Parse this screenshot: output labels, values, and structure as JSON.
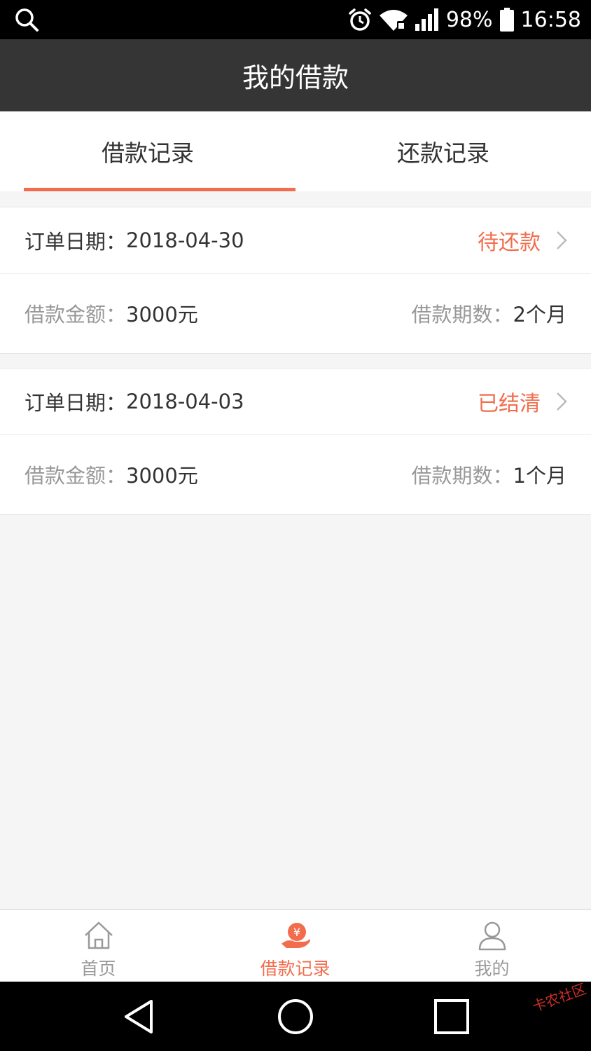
{
  "status_bar": {
    "battery": "98%",
    "time": "16:58",
    "icons": [
      "search-icon",
      "alarm-icon",
      "wifi-icon",
      "signal-icon",
      "battery-icon"
    ]
  },
  "header": {
    "title": "我的借款"
  },
  "tabs": [
    {
      "label": "借款记录",
      "active": true
    },
    {
      "label": "还款记录",
      "active": false
    }
  ],
  "records": [
    {
      "date_label": "订单日期：",
      "date": "2018-04-30",
      "status": "待还款",
      "amount_label": "借款金额：",
      "amount": "3000元",
      "term_label": "借款期数：",
      "term": "2个月"
    },
    {
      "date_label": "订单日期：",
      "date": "2018-04-03",
      "status": "已结清",
      "amount_label": "借款金额：",
      "amount": "3000元",
      "term_label": "借款期数：",
      "term": "1个月"
    }
  ],
  "bottom_nav": [
    {
      "label": "首页",
      "icon": "home-icon",
      "active": false
    },
    {
      "label": "借款记录",
      "icon": "loan-hand-yen-icon",
      "active": true
    },
    {
      "label": "我的",
      "icon": "user-icon",
      "active": false
    }
  ],
  "colors": {
    "accent": "#f26d4e",
    "title_bar": "#353535",
    "background": "#f5f5f5"
  },
  "watermark": "卡农社区"
}
